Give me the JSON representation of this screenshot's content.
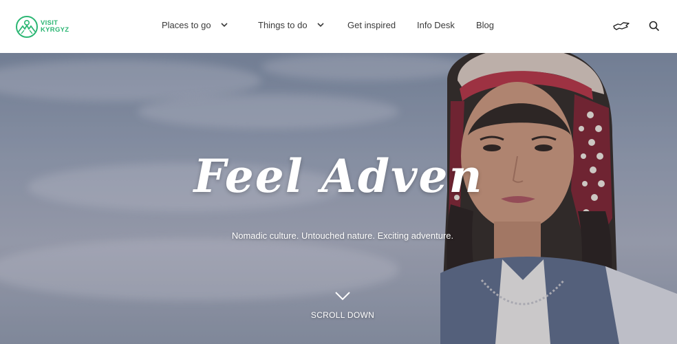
{
  "brand": {
    "line1": "VISIT",
    "line2": "KYRGYZ",
    "color": "#2bb673"
  },
  "nav": {
    "items": [
      {
        "label": "Places to go",
        "has_dropdown": true
      },
      {
        "label": "Things to do",
        "has_dropdown": true
      },
      {
        "label": "Get inspired",
        "has_dropdown": false
      },
      {
        "label": "Info Desk",
        "has_dropdown": false
      },
      {
        "label": "Blog",
        "has_dropdown": false
      }
    ]
  },
  "header_icons": [
    "map-icon",
    "search-icon"
  ],
  "hero": {
    "headline": "Feel Adven",
    "tagline": "Nomadic culture. Untouched nature. Exciting adventure.",
    "scroll_label": "SCROLL DOWN"
  }
}
